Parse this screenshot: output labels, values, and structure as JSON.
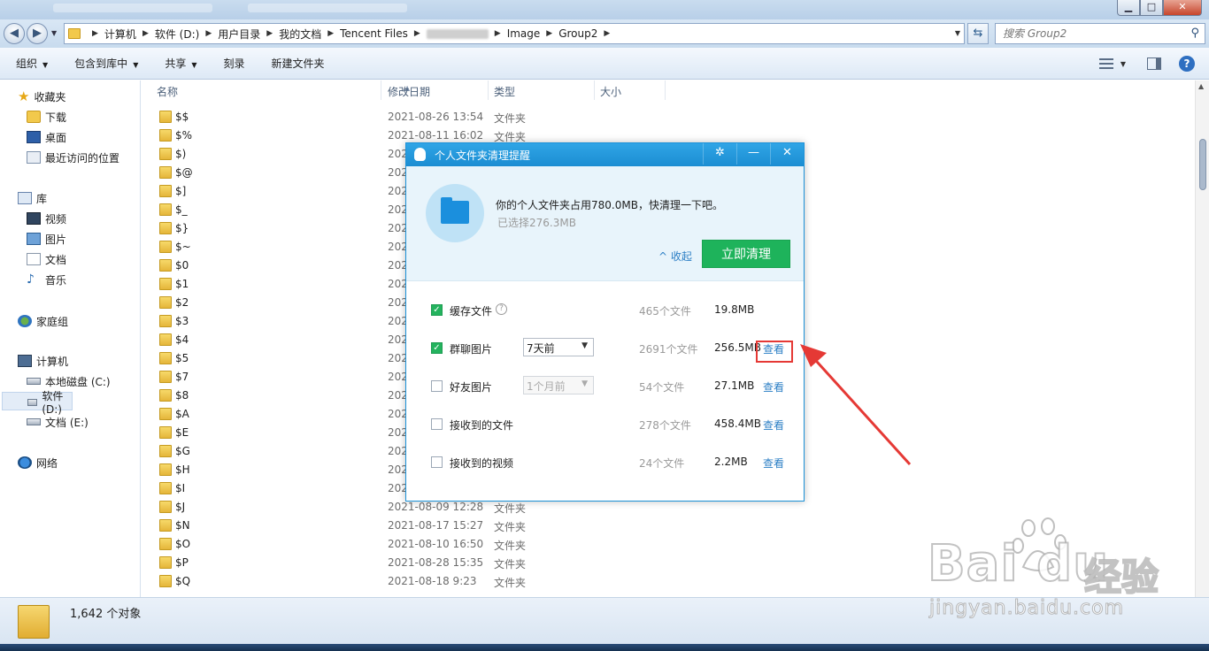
{
  "window": {
    "minimize_glyph": "▁",
    "maximize_glyph": "□",
    "close_glyph": "✕"
  },
  "address": {
    "crumbs": [
      "计算机",
      "软件 (D:)",
      "用户目录",
      "我的文档",
      "Tencent Files"
    ],
    "crumbs_after": [
      "Image",
      "Group2"
    ],
    "search_placeholder": "搜索 Group2"
  },
  "toolbar": {
    "organize": "组织",
    "include_in_library": "包含到库中",
    "share": "共享",
    "burn": "刻录",
    "new_folder": "新建文件夹"
  },
  "nav": {
    "favorites": "收藏夹",
    "downloads": "下载",
    "desktop": "桌面",
    "recent": "最近访问的位置",
    "libraries": "库",
    "videos": "视频",
    "pictures": "图片",
    "documents": "文档",
    "music": "音乐",
    "homegroup": "家庭组",
    "computer": "计算机",
    "drive_c": "本地磁盘 (C:)",
    "drive_d": "软件 (D:)",
    "drive_e": "文档 (E:)",
    "network": "网络"
  },
  "columns": {
    "name": "名称",
    "modified": "修改日期",
    "type": "类型",
    "size": "大小"
  },
  "files": [
    {
      "name": "$$",
      "date": "2021-08-26 13:54",
      "type": "文件夹"
    },
    {
      "name": "$%",
      "date": "2021-08-11 16:02",
      "type": "文件夹"
    },
    {
      "name": "$)",
      "date": "202",
      "type": ""
    },
    {
      "name": "$@",
      "date": "202",
      "type": ""
    },
    {
      "name": "$]",
      "date": "202",
      "type": ""
    },
    {
      "name": "$_",
      "date": "202",
      "type": ""
    },
    {
      "name": "$}",
      "date": "202",
      "type": ""
    },
    {
      "name": "$~",
      "date": "202",
      "type": ""
    },
    {
      "name": "$0",
      "date": "202",
      "type": ""
    },
    {
      "name": "$1",
      "date": "202",
      "type": ""
    },
    {
      "name": "$2",
      "date": "202",
      "type": ""
    },
    {
      "name": "$3",
      "date": "202",
      "type": ""
    },
    {
      "name": "$4",
      "date": "202",
      "type": ""
    },
    {
      "name": "$5",
      "date": "202",
      "type": ""
    },
    {
      "name": "$7",
      "date": "202",
      "type": ""
    },
    {
      "name": "$8",
      "date": "202",
      "type": ""
    },
    {
      "name": "$A",
      "date": "202",
      "type": ""
    },
    {
      "name": "$E",
      "date": "202",
      "type": ""
    },
    {
      "name": "$G",
      "date": "202",
      "type": ""
    },
    {
      "name": "$H",
      "date": "202",
      "type": ""
    },
    {
      "name": "$I",
      "date": "202",
      "type": ""
    },
    {
      "name": "$J",
      "date": "2021-08-09 12:28",
      "type": "文件夹"
    },
    {
      "name": "$N",
      "date": "2021-08-17 15:27",
      "type": "文件夹"
    },
    {
      "name": "$O",
      "date": "2021-08-10 16:50",
      "type": "文件夹"
    },
    {
      "name": "$P",
      "date": "2021-08-28 15:35",
      "type": "文件夹"
    },
    {
      "name": "$Q",
      "date": "2021-08-18 9:23",
      "type": "文件夹"
    }
  ],
  "status": {
    "count": "1,642 个对象"
  },
  "dialog": {
    "title": "个人文件夹清理提醒",
    "settings_glyph": "✲",
    "minimize_glyph": "—",
    "close_glyph": "✕",
    "message": "你的个人文件夹占用780.0MB，快清理一下吧。",
    "selected": "已选择276.3MB",
    "collapse": "^ 收起",
    "clean_now": "立即清理",
    "items": [
      {
        "label": "缓存文件",
        "checked": true,
        "count": "465个文件",
        "size": "19.8MB",
        "view": ""
      },
      {
        "label": "群聊图片",
        "checked": true,
        "select": "7天前",
        "count": "2691个文件",
        "size": "256.5MB",
        "view": "查看"
      },
      {
        "label": "好友图片",
        "checked": false,
        "select": "1个月前",
        "count": "54个文件",
        "size": "27.1MB",
        "view": "查看"
      },
      {
        "label": "接收到的文件",
        "checked": false,
        "count": "278个文件",
        "size": "458.4MB",
        "view": "查看"
      },
      {
        "label": "接收到的视频",
        "checked": false,
        "count": "24个文件",
        "size": "2.2MB",
        "view": "查看"
      }
    ]
  },
  "watermark": {
    "logo": "Bai  du",
    "brand_cn": "经验",
    "url": "jingyan.baidu.com"
  },
  "colors": {
    "accent_blue": "#1b8dd2",
    "clean_green": "#1eb35b",
    "link_blue": "#2c7fc5",
    "highlight_red": "#e53935"
  }
}
